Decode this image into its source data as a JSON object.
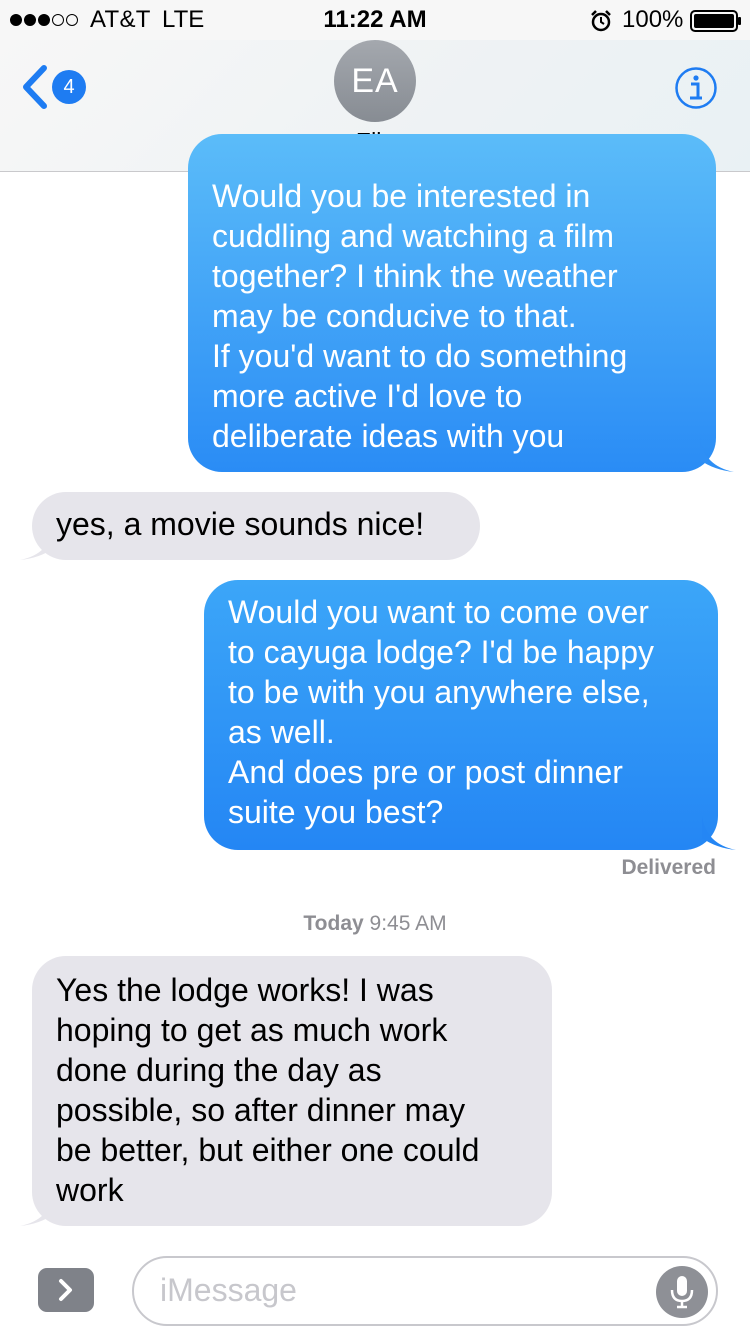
{
  "status_bar": {
    "carrier": "AT&T",
    "network": "LTE",
    "time": "11:22 AM",
    "battery": "100%",
    "signal_bars_filled": 3,
    "signal_bars_total": 5
  },
  "nav": {
    "back_badge": "4",
    "avatar_initials": "EA",
    "contact_name": "Ella"
  },
  "messages": [
    {
      "direction": "outgoing",
      "lines": [
        "Would you be interested in",
        "cuddling and watching a film",
        "together? I think the weather",
        "may be conducive to that.",
        "If you'd want to do something",
        "more active I'd love to",
        "deliberate ideas with you"
      ]
    },
    {
      "direction": "incoming",
      "lines": [
        "yes, a movie sounds nice!"
      ]
    },
    {
      "direction": "outgoing",
      "lines": [
        "Would you want to come over",
        "to cayuga lodge? I'd be happy",
        "to be with you anywhere else,",
        "as well.",
        "And does pre or post dinner",
        "suite you best?"
      ]
    },
    {
      "direction": "incoming",
      "lines": [
        "Yes the lodge works! I was",
        "hoping to get as much work",
        "done during the day as",
        "possible, so after dinner may",
        "be better, but either one could",
        "work"
      ]
    }
  ],
  "delivered_label": "Delivered",
  "timestamp": {
    "day": "Today",
    "time": "9:45 AM"
  },
  "input": {
    "placeholder": "iMessage"
  },
  "colors": {
    "outgoing_top": "#5bbcf9",
    "outgoing_bottom": "#2a8cf5",
    "incoming": "#e6e5eb",
    "accent": "#1e7cf2"
  },
  "icons": [
    "back-chevron-icon",
    "info-icon",
    "alarm-icon",
    "battery-icon",
    "app-drawer-chevron-icon",
    "microphone-icon"
  ]
}
